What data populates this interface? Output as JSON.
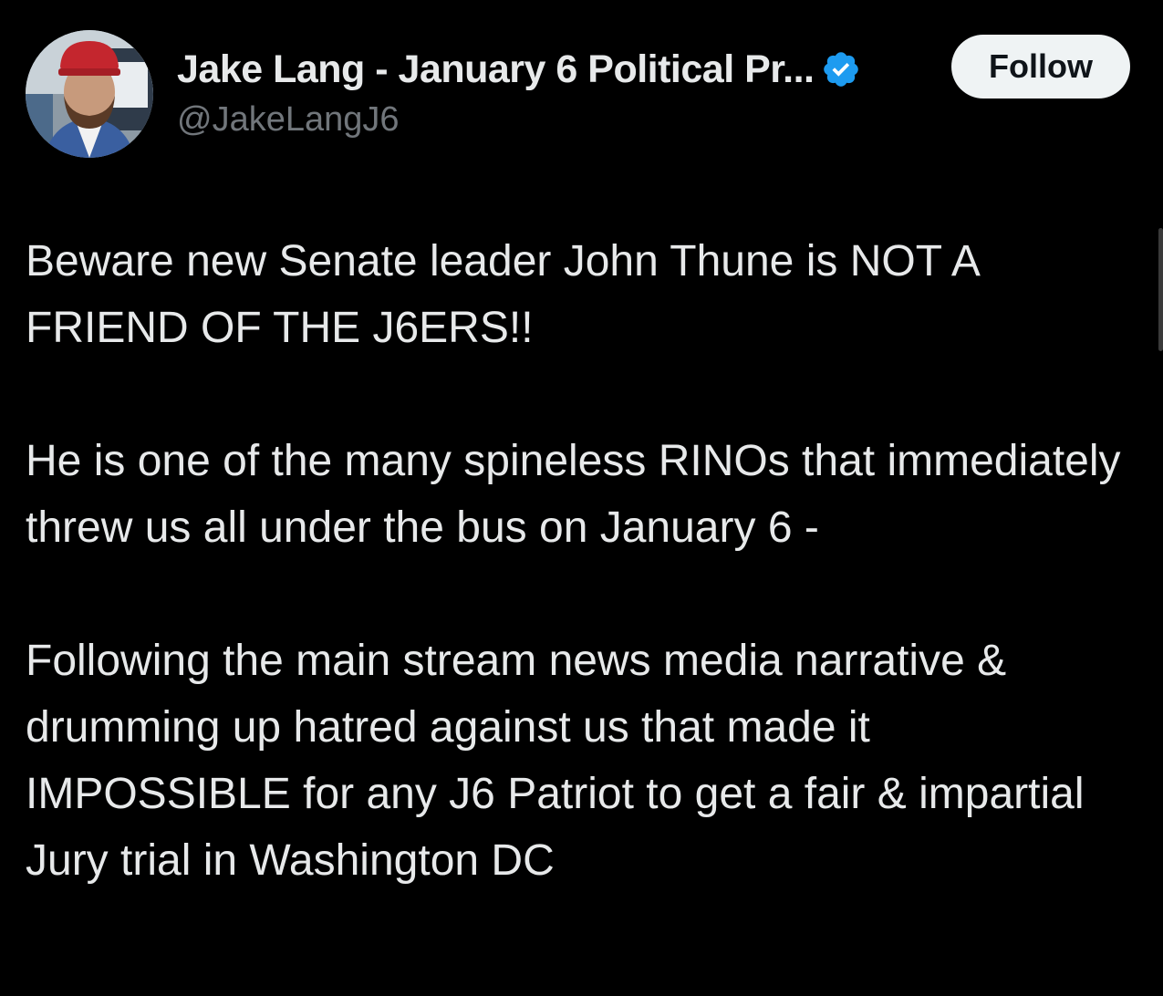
{
  "author": {
    "display_name": "Jake Lang - January 6 Political Pr...",
    "handle": "@JakeLangJ6",
    "verified_icon": "verified-badge-icon",
    "avatar_icon": "avatar-photo"
  },
  "actions": {
    "follow_label": "Follow"
  },
  "tweet": {
    "paragraphs": [
      "Beware new Senate leader John Thune is NOT A FRIEND OF THE J6ERS!!",
      "He is one of the many spineless RINOs that immediately threw us all under the bus on January 6 -",
      "Following the main stream news media narrative & drumming up hatred against us that made it IMPOSSIBLE for any J6 Patriot to get a fair & impartial Jury trial in Washington DC"
    ]
  },
  "colors": {
    "background": "#000000",
    "primary_text": "#e7e9ea",
    "secondary_text": "#71767b",
    "verified_blue": "#1d9bf0",
    "follow_bg": "#eff3f4",
    "follow_text": "#0f1419"
  }
}
